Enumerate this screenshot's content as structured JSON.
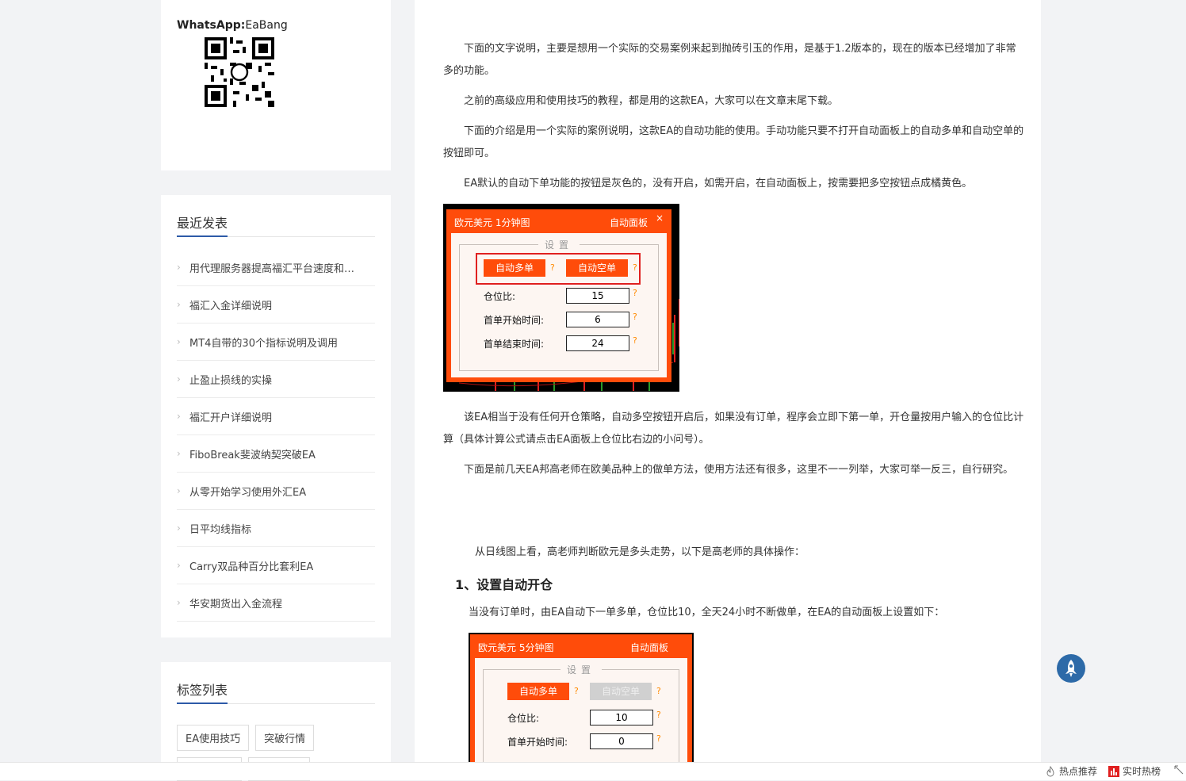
{
  "sidebar": {
    "whatsapp": {
      "label": "WhatsApp:",
      "value": "EaBang"
    },
    "recent": {
      "title": "最近发表",
      "items": [
        "用代理服务器提高福汇平台速度和…",
        "福汇入金详细说明",
        "MT4自带的30个指标说明及调用",
        "止盈止损线的实操",
        "福汇开户详细说明",
        " FiboBreak斐波纳契突破EA",
        "从零开始学习使用外汇EA",
        "日平均线指标",
        "Carry双品种百分比套利EA",
        "华安期货出入金流程"
      ]
    },
    "tags": {
      "title": "标签列表",
      "items": [
        "EA使用技巧",
        "突破行情"
      ]
    }
  },
  "article": {
    "p1": "下面的文字说明，主要是想用一个实际的交易案例来起到抛砖引玉的作用，是基于1.2版本的，现在的版本已经增加了非常多的功能。",
    "p2": "之前的高级应用和使用技巧的教程，都是用的这款EA，大家可以在文章末尾下载。",
    "p3": "下面的介绍是用一个实际的案例说明，这款EA的自动功能的使用。手动功能只要不打开自动面板上的自动多单和自动空单的按钮即可。",
    "p4": "EA默认的自动下单功能的按钮是灰色的，没有开启，如需开启，在自动面板上，按需要把多空按钮点成橘黄色。",
    "p5": "该EA相当于没有任何开仓策略，自动多空按钮开启后，如果没有订单，程序会立即下第一单，开仓量按用户输入的仓位比计算（具体计算公式请点击EA面板上仓位比右边的小问号）。",
    "p6": "下面是前几天EA邦高老师在欧美品种上的做单方法，使用方法还有很多，这里不一一列举，大家可举一反三，自行研究。",
    "p7": "从日线图上看，高老师判断欧元是多头走势，以下是高老师的具体操作：",
    "h1": "1、设置自动开仓",
    "p8": "当没有订单时，由EA自动下一单多单，仓位比10，全天24小时不断做单，在EA的自动面板上设置如下：",
    "panel1": {
      "chart_title": "欧元美元 1分钟图",
      "panel_title": "自动面板",
      "close": "×",
      "legend": "设置",
      "btn_long": "自动多单",
      "btn_short": "自动空单",
      "q": "?",
      "ratio_label": "仓位比:",
      "ratio_value": "15",
      "start_label": "首单开始时间:",
      "start_value": "6",
      "end_label": "首单结束时间:",
      "end_value": "24"
    },
    "panel2": {
      "chart_title": "欧元美元 5分钟图",
      "panel_title": "自动面板",
      "legend": "设置",
      "btn_long": "自动多单",
      "btn_short": "自动空单",
      "q": "?",
      "ratio_label": "仓位比:",
      "ratio_value": "10",
      "start_label": "首单开始时间:",
      "start_value": "0"
    }
  },
  "bottom_bar": {
    "hot": "热点推荐",
    "realtime": "实时热榜"
  },
  "colors": {
    "accent": "#2d5aa8",
    "ea_orange": "#ff4c0a",
    "highlight_red": "#e02020"
  }
}
